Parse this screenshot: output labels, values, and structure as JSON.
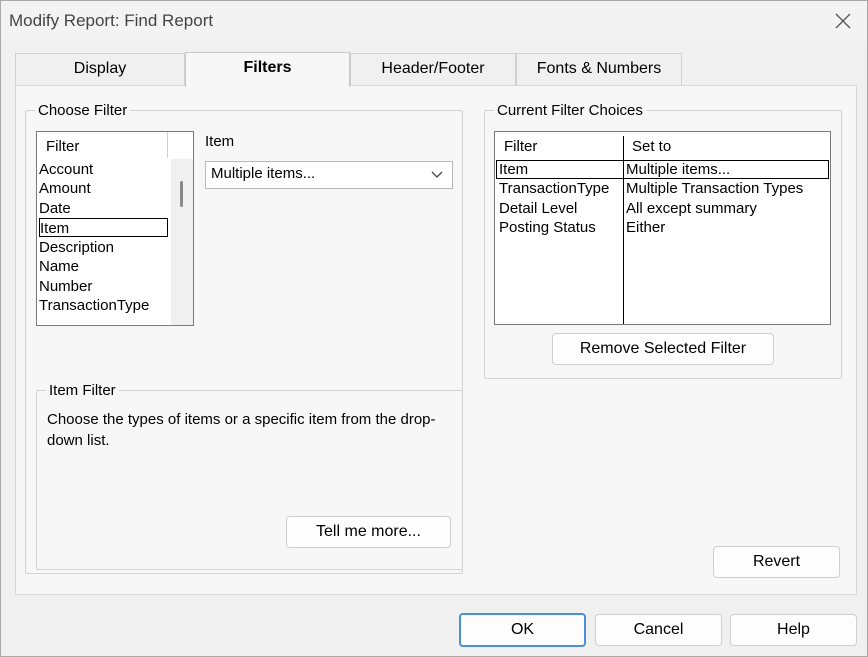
{
  "window": {
    "title": "Modify Report: Find Report"
  },
  "tabs": [
    {
      "label": "Display",
      "mnemonic": "D"
    },
    {
      "label": "Filters",
      "mnemonic": "F"
    },
    {
      "label": "Header/Footer",
      "mnemonic": "H"
    },
    {
      "label": "Fonts & Numbers",
      "mnemonic": "t"
    }
  ],
  "choose_filter": {
    "legend": "Choose Filter",
    "list_header": "Filter",
    "items": [
      "Account",
      "Amount",
      "Date",
      "Item",
      "Description",
      "Name",
      "Number",
      "TransactionType"
    ],
    "selected": "Item",
    "item_label": "Item",
    "item_value": "Multiple items..."
  },
  "item_filter": {
    "legend": "Item Filter",
    "description": "Choose the types of items or a specific item from the drop-down list.",
    "tell_me_more": "Tell me more..."
  },
  "current_choices": {
    "legend": "Current Filter Choices",
    "col_filter": "Filter",
    "col_set_to": "Set to",
    "rows": [
      {
        "filter": "Item",
        "set_to": "Multiple items..."
      },
      {
        "filter": "TransactionType",
        "set_to": "Multiple Transaction Types"
      },
      {
        "filter": "Detail Level",
        "set_to": "All except summary"
      },
      {
        "filter": "Posting Status",
        "set_to": "Either"
      }
    ],
    "remove_button": "Remove Selected Filter"
  },
  "buttons": {
    "revert": "Revert",
    "ok": "OK",
    "cancel": "Cancel",
    "help": "Help"
  },
  "colors": {
    "accent_border": "#4c8fd6"
  }
}
